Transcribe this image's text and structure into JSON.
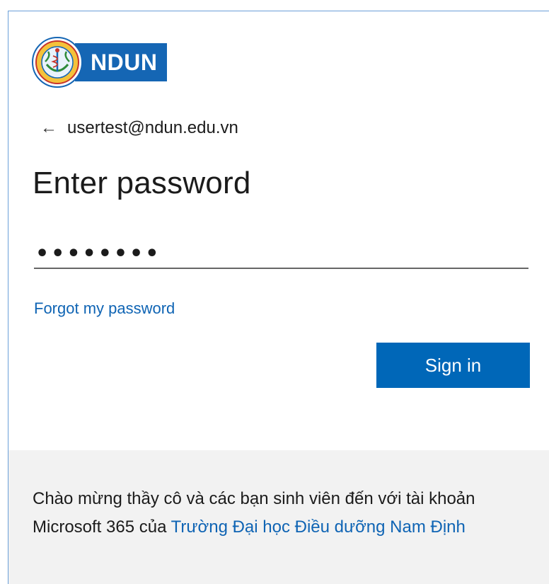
{
  "logo": {
    "text": "NDUN"
  },
  "account": {
    "back_arrow": "←",
    "email": "usertest@ndun.edu.vn"
  },
  "page": {
    "title": "Enter password"
  },
  "password": {
    "value": "••••••••"
  },
  "links": {
    "forgot": "Forgot my password"
  },
  "actions": {
    "signin_label": "Sign in"
  },
  "footer": {
    "message": "Chào mừng thầy cô và các bạn sinh viên đến với tài khoản Microsoft 365 của ",
    "link_text": "Trường Đại học Điều dưỡng Nam Định"
  },
  "colors": {
    "brand": "#1566b4",
    "button": "#0067b8",
    "link": "#0f64b4",
    "footer_bg": "#f2f2f2"
  },
  "icons": {
    "back": "back-arrow-icon",
    "seal": "university-seal-logo"
  }
}
